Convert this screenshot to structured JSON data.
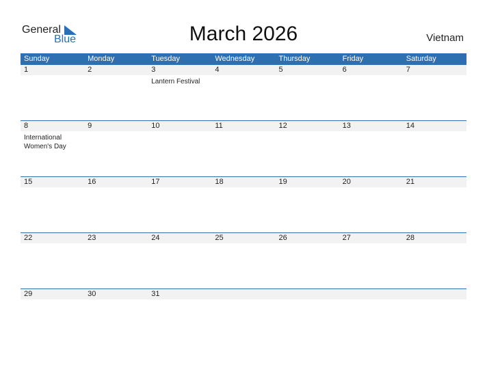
{
  "logo": {
    "general": "General",
    "blue": "Blue"
  },
  "title": "March 2026",
  "country": "Vietnam",
  "weekdays": [
    "Sunday",
    "Monday",
    "Tuesday",
    "Wednesday",
    "Thursday",
    "Friday",
    "Saturday"
  ],
  "weeks": [
    {
      "days": [
        "1",
        "2",
        "3",
        "4",
        "5",
        "6",
        "7"
      ],
      "events": [
        "",
        "",
        "Lantern Festival",
        "",
        "",
        "",
        ""
      ]
    },
    {
      "days": [
        "8",
        "9",
        "10",
        "11",
        "12",
        "13",
        "14"
      ],
      "events": [
        "International Women's Day",
        "",
        "",
        "",
        "",
        "",
        ""
      ]
    },
    {
      "days": [
        "15",
        "16",
        "17",
        "18",
        "19",
        "20",
        "21"
      ],
      "events": [
        "",
        "",
        "",
        "",
        "",
        "",
        ""
      ]
    },
    {
      "days": [
        "22",
        "23",
        "24",
        "25",
        "26",
        "27",
        "28"
      ],
      "events": [
        "",
        "",
        "",
        "",
        "",
        "",
        ""
      ]
    },
    {
      "days": [
        "29",
        "30",
        "31",
        "",
        "",
        "",
        ""
      ],
      "events": [
        "",
        "",
        "",
        "",
        "",
        "",
        ""
      ]
    }
  ],
  "colors": {
    "accent": "#2e6fb2",
    "day_row_bg": "#f2f2f2"
  }
}
